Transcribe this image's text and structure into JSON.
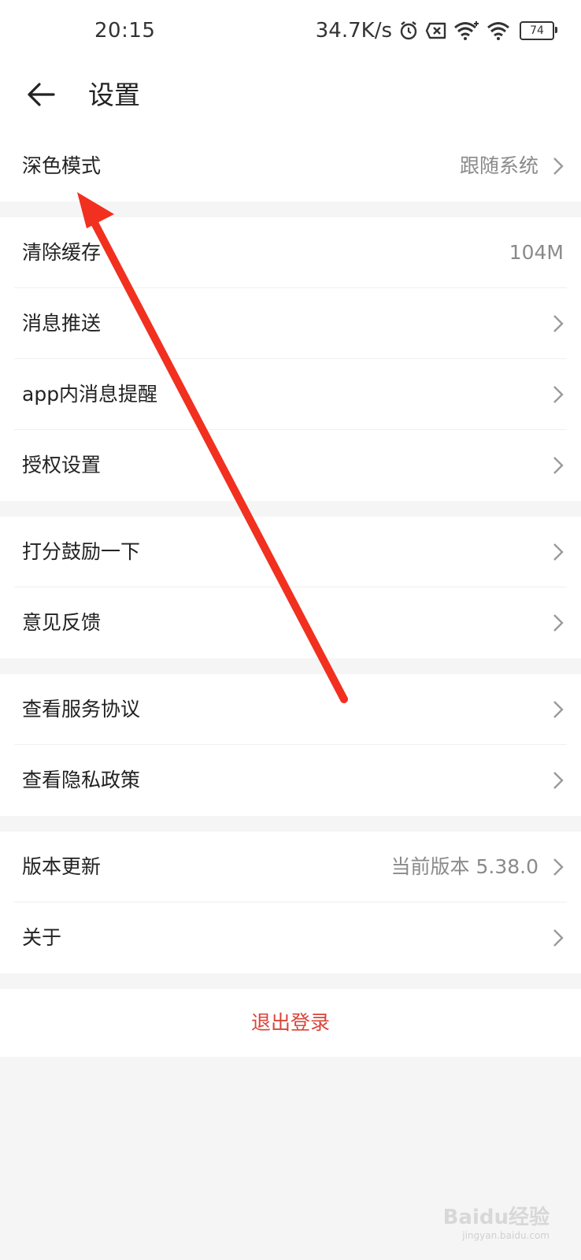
{
  "status_bar": {
    "time": "20:15",
    "speed": "34.7K/s",
    "icons": [
      "alarm-icon",
      "sim-disabled-icon",
      "wifi-plus-icon",
      "wifi-icon"
    ],
    "battery": "74"
  },
  "header": {
    "back_icon": "arrow-left-icon",
    "title": "设置"
  },
  "groups": [
    {
      "items": [
        {
          "label": "深色模式",
          "value": "跟随系统",
          "chevron": true
        }
      ]
    },
    {
      "items": [
        {
          "label": "清除缓存",
          "value": "104M",
          "chevron": false
        },
        {
          "label": "消息推送",
          "value": "",
          "chevron": true
        },
        {
          "label": "app内消息提醒",
          "value": "",
          "chevron": true
        },
        {
          "label": "授权设置",
          "value": "",
          "chevron": true
        }
      ]
    },
    {
      "items": [
        {
          "label": "打分鼓励一下",
          "value": "",
          "chevron": true
        },
        {
          "label": "意见反馈",
          "value": "",
          "chevron": true
        }
      ]
    },
    {
      "items": [
        {
          "label": "查看服务协议",
          "value": "",
          "chevron": true
        },
        {
          "label": "查看隐私政策",
          "value": "",
          "chevron": true
        }
      ]
    },
    {
      "items": [
        {
          "label": "版本更新",
          "value": "当前版本 5.38.0",
          "chevron": true
        },
        {
          "label": "关于",
          "value": "",
          "chevron": true
        }
      ]
    }
  ],
  "logout_label": "退出登录",
  "annotation": {
    "type": "red-arrow",
    "color": "#f2301f",
    "points_to": "深色模式"
  },
  "watermark": {
    "text": "Baidu经验",
    "subtext": "jingyan.baidu.com"
  },
  "colors": {
    "logout": "#d9453a",
    "secondary_text": "#8a8a8a",
    "background": "#f5f5f5"
  }
}
